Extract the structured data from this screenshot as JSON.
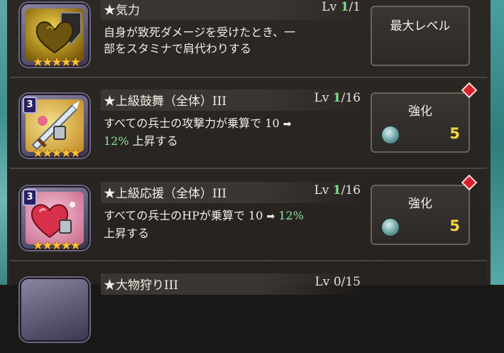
{
  "skills": [
    {
      "name": "★気力",
      "level_prefix": "Lv",
      "level_current": "1",
      "level_max": "/1",
      "desc_line1": "自身が致死ダメージを受けたとき、一",
      "desc_line2": "部をスタミナで肩代わりする",
      "button_label": "最大レベル",
      "rank": "",
      "stars": "★★★★★"
    },
    {
      "name": "★上級鼓舞（全体）III",
      "level_prefix": "Lv",
      "level_current": "1",
      "level_max": "/16",
      "desc_a": "すべての兵士の攻撃力が乗算で 10 ",
      "arrow": "➡",
      "desc_hl": "12%",
      "desc_b": " 上昇する",
      "button_label": "強化",
      "cost": "5",
      "rank": "3",
      "stars": "★★★★★"
    },
    {
      "name": "★上級応援（全体）III",
      "level_prefix": "Lv",
      "level_current": "1",
      "level_max": "/16",
      "desc_a": "すべての兵士のHPが乗算で 10 ",
      "arrow": "➡",
      "desc_hl": "12%",
      "desc_b": "上昇する",
      "button_label": "強化",
      "cost": "5",
      "rank": "3",
      "stars": "★★★★★"
    },
    {
      "name": "★大物狩りIII",
      "level_prefix": "Lv",
      "level_current": "0",
      "level_max": "/15"
    }
  ]
}
